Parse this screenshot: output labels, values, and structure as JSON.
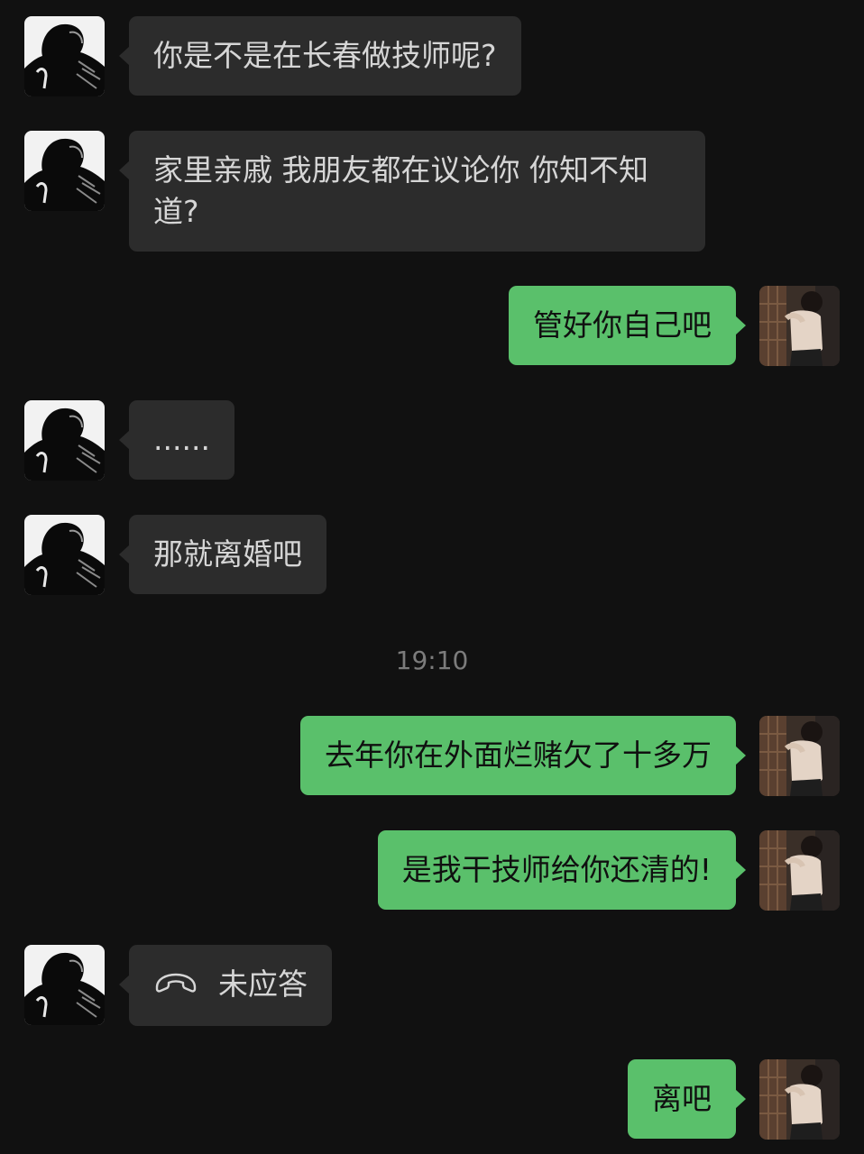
{
  "conversation": {
    "timestamp": "19:10",
    "messages": [
      {
        "side": "in",
        "text": "你是不是在长春做技师呢?"
      },
      {
        "side": "in",
        "text": "家里亲戚 我朋友都在议论你 你知不知道?"
      },
      {
        "side": "out",
        "text": "管好你自己吧"
      },
      {
        "side": "in",
        "text": "......"
      },
      {
        "side": "in",
        "text": "那就离婚吧"
      },
      {
        "side": "out",
        "text": "去年你在外面烂赌欠了十多万"
      },
      {
        "side": "out",
        "text": "是我干技师给你还清的!"
      },
      {
        "side": "in",
        "text": "未应答",
        "icon": "phone-hangup-icon"
      },
      {
        "side": "out",
        "text": "离吧"
      }
    ]
  },
  "colors": {
    "background": "#111111",
    "incoming_bubble": "#2c2c2c",
    "outgoing_bubble": "#5ac06b",
    "timestamp_text": "#7c7c7c"
  }
}
